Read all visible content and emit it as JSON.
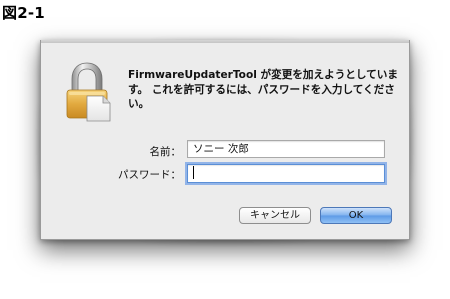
{
  "figure_label": "図2-1",
  "dialog": {
    "message": "FirmwareUpdaterTool が変更を加えようとしています。 これを許可するには、パスワードを入力してください。",
    "icon": "lock-document-icon",
    "fields": {
      "name_label": "名前：",
      "name_value": "ソニー 次郎",
      "password_label": "パスワード：",
      "password_value": ""
    },
    "buttons": {
      "cancel_label": "キャンセル",
      "ok_label": "OK"
    }
  },
  "colors": {
    "dialog_bg": "#ececec",
    "focus_ring": "#6297e6",
    "default_button": "#7fb2ee",
    "lock_gold": "#e8b04a"
  }
}
